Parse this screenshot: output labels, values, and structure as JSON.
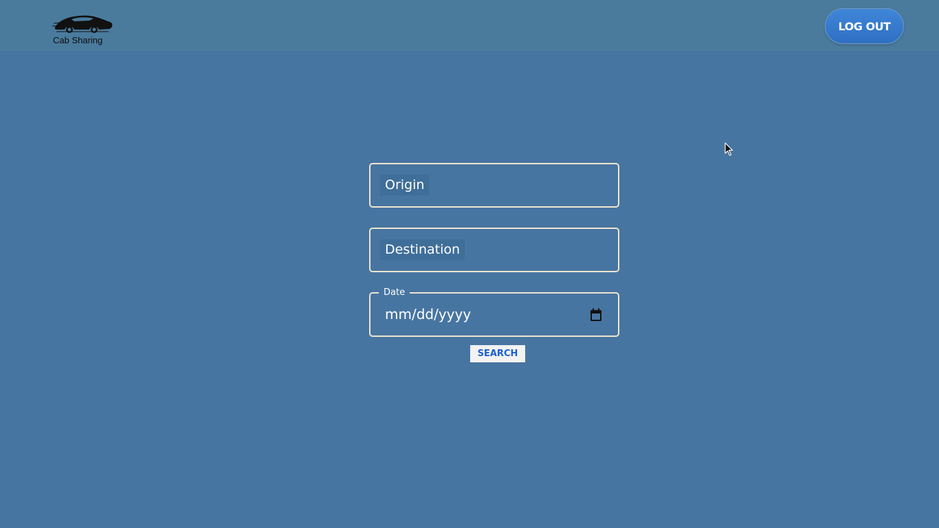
{
  "header": {
    "logo_text": "Cab Sharing",
    "logout_label": "LOG OUT"
  },
  "form": {
    "origin_placeholder": "Origin",
    "destination_placeholder": "Destination",
    "date_label": "Date",
    "date_value": "mm/dd/yyyy",
    "search_label": "SEARCH"
  },
  "icons": {
    "logo": "car-icon",
    "calendar": "calendar-icon",
    "cursor": "mouse-cursor-icon"
  },
  "colors": {
    "background": "#4775a1",
    "header": "#4a7b9d",
    "field_border": "#efe6cf",
    "logout_button": "#3a7fcf",
    "search_text": "#1a5fd4"
  }
}
